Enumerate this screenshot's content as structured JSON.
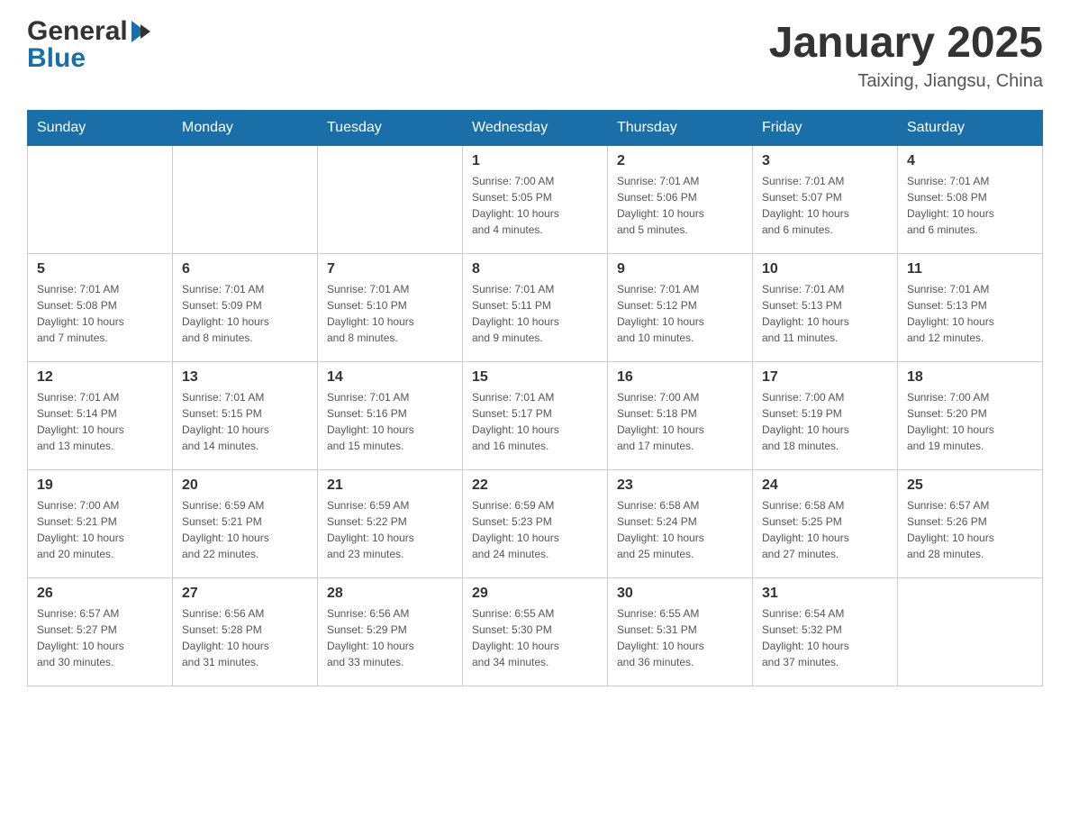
{
  "header": {
    "title": "January 2025",
    "location": "Taixing, Jiangsu, China",
    "logo": {
      "general": "General",
      "blue": "Blue"
    }
  },
  "calendar": {
    "days_of_week": [
      "Sunday",
      "Monday",
      "Tuesday",
      "Wednesday",
      "Thursday",
      "Friday",
      "Saturday"
    ],
    "weeks": [
      [
        {
          "day": "",
          "info": ""
        },
        {
          "day": "",
          "info": ""
        },
        {
          "day": "",
          "info": ""
        },
        {
          "day": "1",
          "info": "Sunrise: 7:00 AM\nSunset: 5:05 PM\nDaylight: 10 hours\nand 4 minutes."
        },
        {
          "day": "2",
          "info": "Sunrise: 7:01 AM\nSunset: 5:06 PM\nDaylight: 10 hours\nand 5 minutes."
        },
        {
          "day": "3",
          "info": "Sunrise: 7:01 AM\nSunset: 5:07 PM\nDaylight: 10 hours\nand 6 minutes."
        },
        {
          "day": "4",
          "info": "Sunrise: 7:01 AM\nSunset: 5:08 PM\nDaylight: 10 hours\nand 6 minutes."
        }
      ],
      [
        {
          "day": "5",
          "info": "Sunrise: 7:01 AM\nSunset: 5:08 PM\nDaylight: 10 hours\nand 7 minutes."
        },
        {
          "day": "6",
          "info": "Sunrise: 7:01 AM\nSunset: 5:09 PM\nDaylight: 10 hours\nand 8 minutes."
        },
        {
          "day": "7",
          "info": "Sunrise: 7:01 AM\nSunset: 5:10 PM\nDaylight: 10 hours\nand 8 minutes."
        },
        {
          "day": "8",
          "info": "Sunrise: 7:01 AM\nSunset: 5:11 PM\nDaylight: 10 hours\nand 9 minutes."
        },
        {
          "day": "9",
          "info": "Sunrise: 7:01 AM\nSunset: 5:12 PM\nDaylight: 10 hours\nand 10 minutes."
        },
        {
          "day": "10",
          "info": "Sunrise: 7:01 AM\nSunset: 5:13 PM\nDaylight: 10 hours\nand 11 minutes."
        },
        {
          "day": "11",
          "info": "Sunrise: 7:01 AM\nSunset: 5:13 PM\nDaylight: 10 hours\nand 12 minutes."
        }
      ],
      [
        {
          "day": "12",
          "info": "Sunrise: 7:01 AM\nSunset: 5:14 PM\nDaylight: 10 hours\nand 13 minutes."
        },
        {
          "day": "13",
          "info": "Sunrise: 7:01 AM\nSunset: 5:15 PM\nDaylight: 10 hours\nand 14 minutes."
        },
        {
          "day": "14",
          "info": "Sunrise: 7:01 AM\nSunset: 5:16 PM\nDaylight: 10 hours\nand 15 minutes."
        },
        {
          "day": "15",
          "info": "Sunrise: 7:01 AM\nSunset: 5:17 PM\nDaylight: 10 hours\nand 16 minutes."
        },
        {
          "day": "16",
          "info": "Sunrise: 7:00 AM\nSunset: 5:18 PM\nDaylight: 10 hours\nand 17 minutes."
        },
        {
          "day": "17",
          "info": "Sunrise: 7:00 AM\nSunset: 5:19 PM\nDaylight: 10 hours\nand 18 minutes."
        },
        {
          "day": "18",
          "info": "Sunrise: 7:00 AM\nSunset: 5:20 PM\nDaylight: 10 hours\nand 19 minutes."
        }
      ],
      [
        {
          "day": "19",
          "info": "Sunrise: 7:00 AM\nSunset: 5:21 PM\nDaylight: 10 hours\nand 20 minutes."
        },
        {
          "day": "20",
          "info": "Sunrise: 6:59 AM\nSunset: 5:21 PM\nDaylight: 10 hours\nand 22 minutes."
        },
        {
          "day": "21",
          "info": "Sunrise: 6:59 AM\nSunset: 5:22 PM\nDaylight: 10 hours\nand 23 minutes."
        },
        {
          "day": "22",
          "info": "Sunrise: 6:59 AM\nSunset: 5:23 PM\nDaylight: 10 hours\nand 24 minutes."
        },
        {
          "day": "23",
          "info": "Sunrise: 6:58 AM\nSunset: 5:24 PM\nDaylight: 10 hours\nand 25 minutes."
        },
        {
          "day": "24",
          "info": "Sunrise: 6:58 AM\nSunset: 5:25 PM\nDaylight: 10 hours\nand 27 minutes."
        },
        {
          "day": "25",
          "info": "Sunrise: 6:57 AM\nSunset: 5:26 PM\nDaylight: 10 hours\nand 28 minutes."
        }
      ],
      [
        {
          "day": "26",
          "info": "Sunrise: 6:57 AM\nSunset: 5:27 PM\nDaylight: 10 hours\nand 30 minutes."
        },
        {
          "day": "27",
          "info": "Sunrise: 6:56 AM\nSunset: 5:28 PM\nDaylight: 10 hours\nand 31 minutes."
        },
        {
          "day": "28",
          "info": "Sunrise: 6:56 AM\nSunset: 5:29 PM\nDaylight: 10 hours\nand 33 minutes."
        },
        {
          "day": "29",
          "info": "Sunrise: 6:55 AM\nSunset: 5:30 PM\nDaylight: 10 hours\nand 34 minutes."
        },
        {
          "day": "30",
          "info": "Sunrise: 6:55 AM\nSunset: 5:31 PM\nDaylight: 10 hours\nand 36 minutes."
        },
        {
          "day": "31",
          "info": "Sunrise: 6:54 AM\nSunset: 5:32 PM\nDaylight: 10 hours\nand 37 minutes."
        },
        {
          "day": "",
          "info": ""
        }
      ]
    ]
  }
}
